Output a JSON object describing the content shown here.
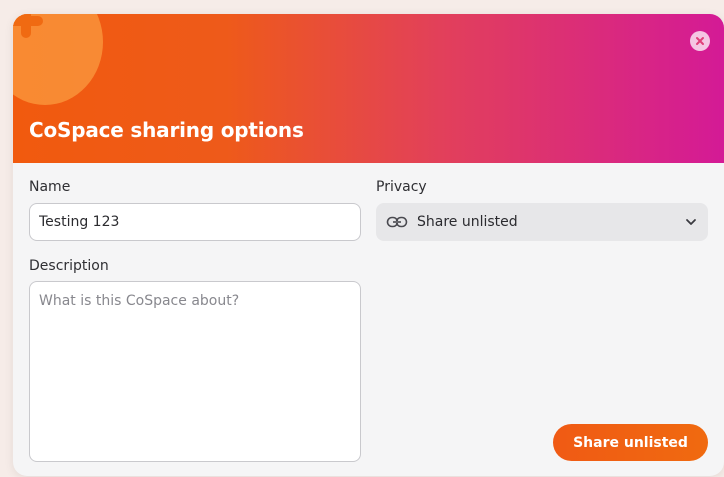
{
  "dialog": {
    "title": "CoSpace sharing options",
    "header_gradient": [
      "#f15a0e",
      "#d41a96"
    ]
  },
  "icons": {
    "plus": "plus-icon",
    "close": "close-icon",
    "link": "link-icon",
    "chevron": "chevron-down-icon"
  },
  "form": {
    "name_label": "Name",
    "name_value": "Testing 123",
    "description_label": "Description",
    "description_value": "",
    "description_placeholder": "What is this CoSpace about?",
    "privacy_label": "Privacy",
    "privacy_value": "Share unlisted"
  },
  "actions": {
    "submit_label": "Share unlisted",
    "submit_color": "#f05a14"
  }
}
